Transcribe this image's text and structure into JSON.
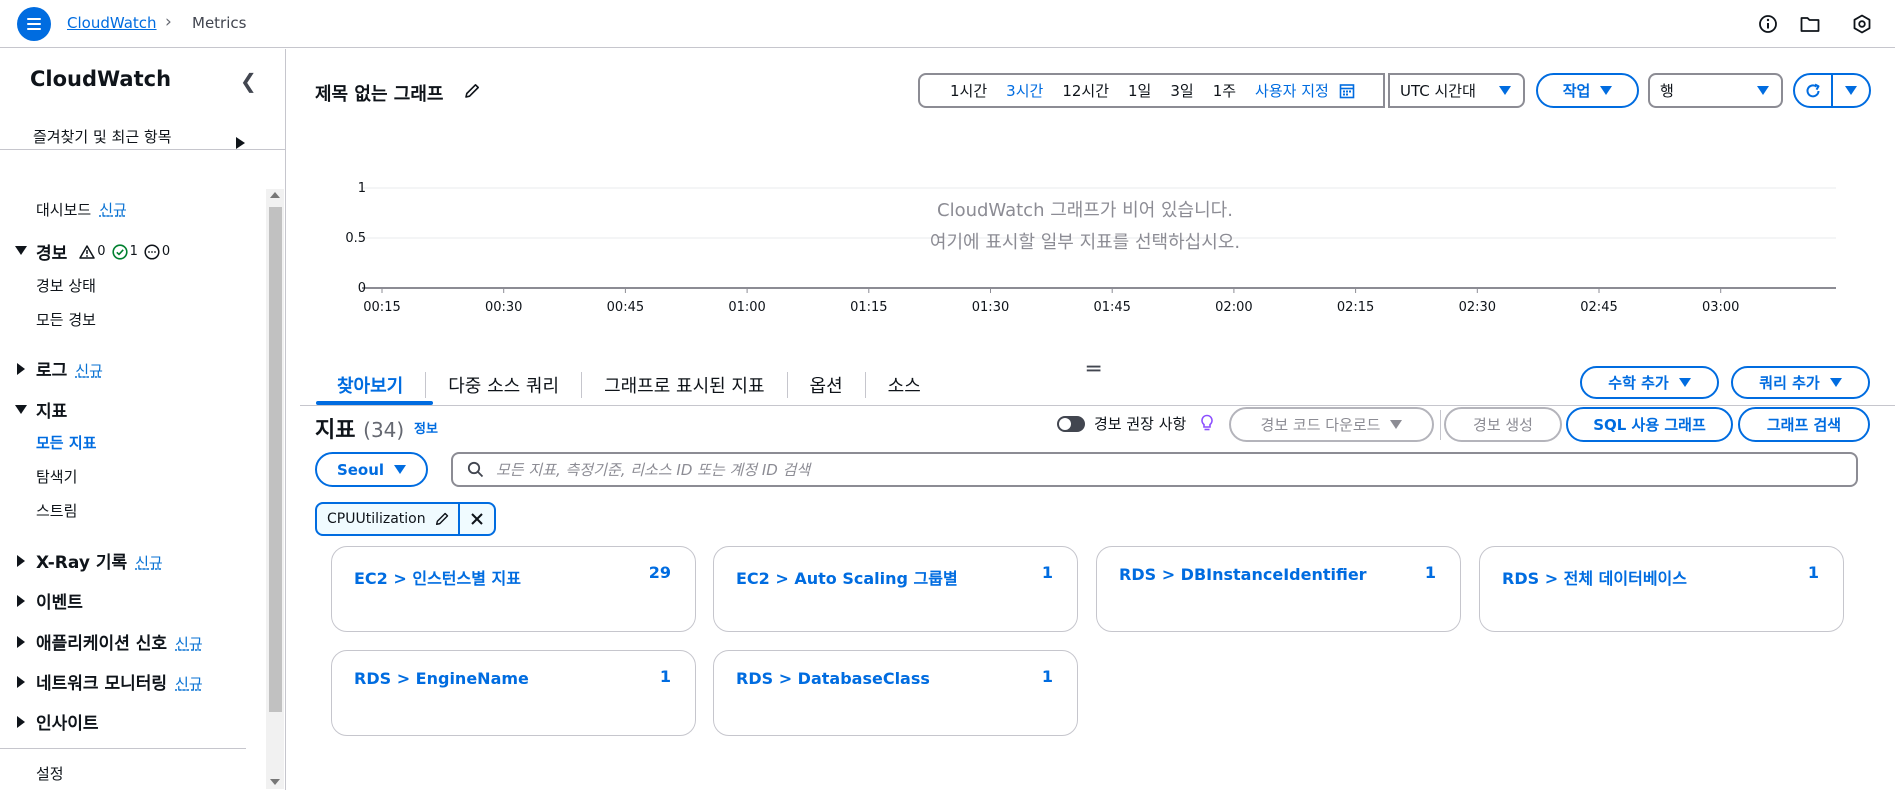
{
  "topbar": {
    "crumb_root": "CloudWatch",
    "crumb_current": "Metrics"
  },
  "sidebar": {
    "title": "CloudWatch",
    "favorites": "즐겨찾기 및 최근 항목",
    "dashboard": {
      "label": "대시보드",
      "badge": "신규"
    },
    "alarms": {
      "label": "경보",
      "counts": {
        "warning": "0",
        "ok": "1",
        "insufficient": "0"
      },
      "items": [
        "경보 상태",
        "모든 경보"
      ]
    },
    "logs": {
      "label": "로그",
      "badge": "신규"
    },
    "metrics": {
      "label": "지표",
      "items": [
        "모든 지표",
        "탐색기",
        "스트림"
      ]
    },
    "xray": {
      "label": "X-Ray 기록",
      "badge": "신규"
    },
    "events": {
      "label": "이벤트"
    },
    "app_signals": {
      "label": "애플리케이션 신호",
      "badge": "신규"
    },
    "network": {
      "label": "네트워크 모니터링",
      "badge": "신규"
    },
    "insights": {
      "label": "인사이트"
    },
    "settings": "설정"
  },
  "header": {
    "graph_title": "제목 없는 그래프",
    "ranges": [
      "1시간",
      "3시간",
      "12시간",
      "1일",
      "3일",
      "1주"
    ],
    "active_range": "3시간",
    "custom_range": "사용자 지정",
    "timezone": "UTC 시간대",
    "actions": "작업",
    "view_select": "행"
  },
  "chart_data": {
    "type": "line",
    "x": [
      "00:15",
      "00:30",
      "00:45",
      "01:00",
      "01:15",
      "01:30",
      "01:45",
      "02:00",
      "02:15",
      "02:30",
      "02:45",
      "03:00"
    ],
    "series": [],
    "yticks": [
      "1",
      "0.5",
      "0"
    ],
    "ylim": [
      0,
      1
    ],
    "empty_title": "CloudWatch 그래프가 비어 있습니다.",
    "empty_hint": "여기에 표시할 일부 지표를 선택하십시오.",
    "grid": true
  },
  "tabs": [
    "찾아보기",
    "다중 소스 쿼리",
    "그래프로 표시된 지표",
    "옵션",
    "소스"
  ],
  "metrics_panel": {
    "title": "지표",
    "count": "(34)",
    "info": "정보",
    "add_math": "수학 추가",
    "add_query": "쿼리 추가",
    "alarm_recommendations": "경보 권장 사항",
    "download_code": "경보 코드 다운로드",
    "create_alarm": "경보 생성",
    "sql_graph": "SQL 사용 그래프",
    "graph_search": "그래프 검색",
    "region": "Seoul",
    "search_placeholder": "모든 지표, 측정기준, 리소스 ID 또는 계정 ID 검색",
    "filter_token": "CPUUtilization",
    "cards": [
      {
        "title": "EC2 > 인스턴스별 지표",
        "count": "29"
      },
      {
        "title": "EC2 > Auto Scaling 그룹별",
        "count": "1"
      },
      {
        "title": "RDS > DBInstanceIdentifier",
        "count": "1"
      },
      {
        "title": "RDS > 전체 데이터베이스",
        "count": "1"
      },
      {
        "title": "RDS > EngineName",
        "count": "1"
      },
      {
        "title": "RDS > DatabaseClass",
        "count": "1"
      }
    ]
  },
  "colors": {
    "accent": "#006ce0",
    "border": "#c6c6cd"
  }
}
